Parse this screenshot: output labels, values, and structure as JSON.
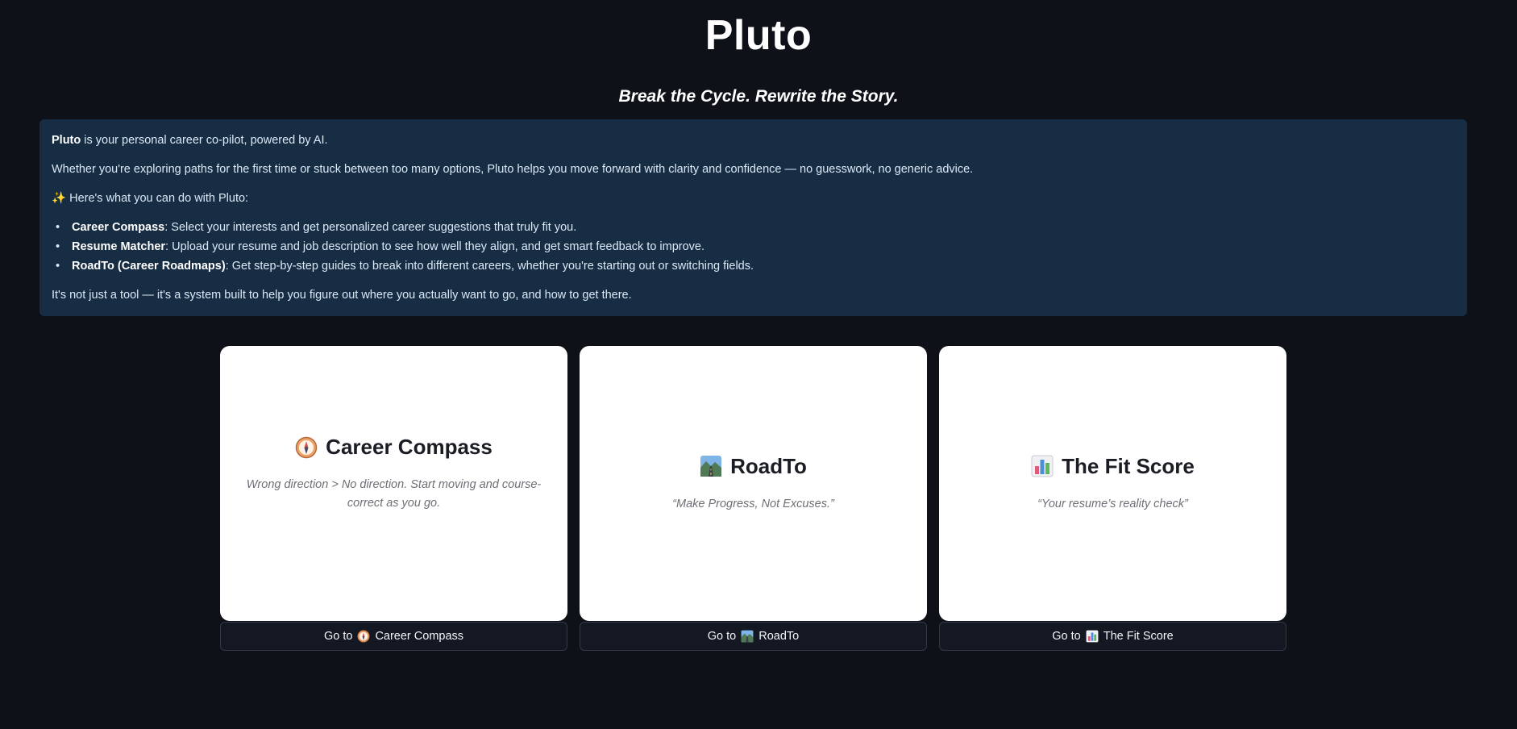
{
  "app": {
    "title": "Pluto",
    "tagline": "Break the Cycle. Rewrite the Story."
  },
  "intro": {
    "line1_bold": "Pluto",
    "line1_rest": " is your personal career co-pilot, powered by AI.",
    "line2": "Whether you're exploring paths for the first time or stuck between too many options, Pluto helps you move forward with clarity and confidence — no guesswork, no generic advice.",
    "features_heading_icon": "✨",
    "features_heading": " Here's what you can do with Pluto:",
    "features": [
      {
        "name": "Career Compass",
        "text": ": Select your interests and get personalized career suggestions that truly fit you."
      },
      {
        "name": "Resume Matcher",
        "text": ": Upload your resume and job description to see how well they align, and get smart feedback to improve."
      },
      {
        "name": "RoadTo (Career Roadmaps)",
        "text": ": Get step-by-step guides to break into different careers, whether you're starting out or switching fields."
      }
    ],
    "closing": "It's not just a tool — it's a system built to help you figure out where you actually want to go, and how to get there.",
    "bullet": "•"
  },
  "cards": [
    {
      "icon": "compass-icon",
      "title": "Career Compass",
      "desc": "Wrong direction > No direction. Start moving and course-correct as you go.",
      "button_prefix": "Go to",
      "button_label": "Career Compass"
    },
    {
      "icon": "road-icon",
      "title": "RoadTo",
      "desc": "“Make Progress, Not Excuses.”",
      "button_prefix": "Go to",
      "button_label": "RoadTo"
    },
    {
      "icon": "bar-chart-icon",
      "title": "The Fit Score",
      "desc": "“Your resume’s reality check”",
      "button_prefix": "Go to",
      "button_label": "The Fit Score"
    }
  ],
  "colors": {
    "background": "#0e1117",
    "info_panel": "#172d43",
    "card": "#ffffff",
    "button_bg": "#141822"
  }
}
